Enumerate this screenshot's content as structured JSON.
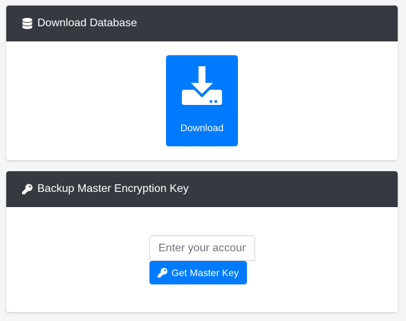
{
  "download_card": {
    "title": "Download Database",
    "title_icon": "database-icon",
    "button_label": "Download",
    "button_icon": "download-icon"
  },
  "backup_card": {
    "title": "Backup Master Encryption Key",
    "title_icon": "key-icon",
    "input_placeholder": "Enter your accoun",
    "button_label": "Get Master Key",
    "button_icon": "key-icon"
  },
  "colors": {
    "header_bg": "#343a40",
    "primary": "#007bff",
    "page_bg": "#f4f5f7"
  }
}
